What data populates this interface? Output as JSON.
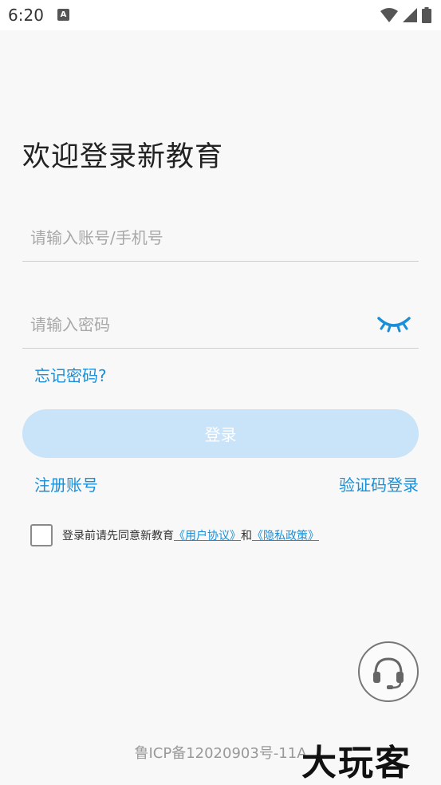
{
  "status_bar": {
    "time": "6:20",
    "notification_icon_letter": "A",
    "icons": [
      "wifi-icon",
      "signal-icon",
      "battery-icon"
    ]
  },
  "login": {
    "title": "欢迎登录新教育",
    "account_placeholder": "请输入账号/手机号",
    "password_placeholder": "请输入密码",
    "forgot_password": "忘记密码?",
    "login_button": "登录",
    "register": "注册账号",
    "sms_login": "验证码登录"
  },
  "agreement": {
    "prefix": "登录前请先同意新教育",
    "user_agreement": "《用户协议》",
    "conjunction": "和",
    "privacy_policy": "《隐私政策》"
  },
  "footer": {
    "icp": "鲁ICP备12020903号-11A",
    "watermark": "大玩客"
  },
  "colors": {
    "accent": "#1a8fd8",
    "login_button_bg": "#c9e3f8",
    "background": "#f8f8f8"
  }
}
